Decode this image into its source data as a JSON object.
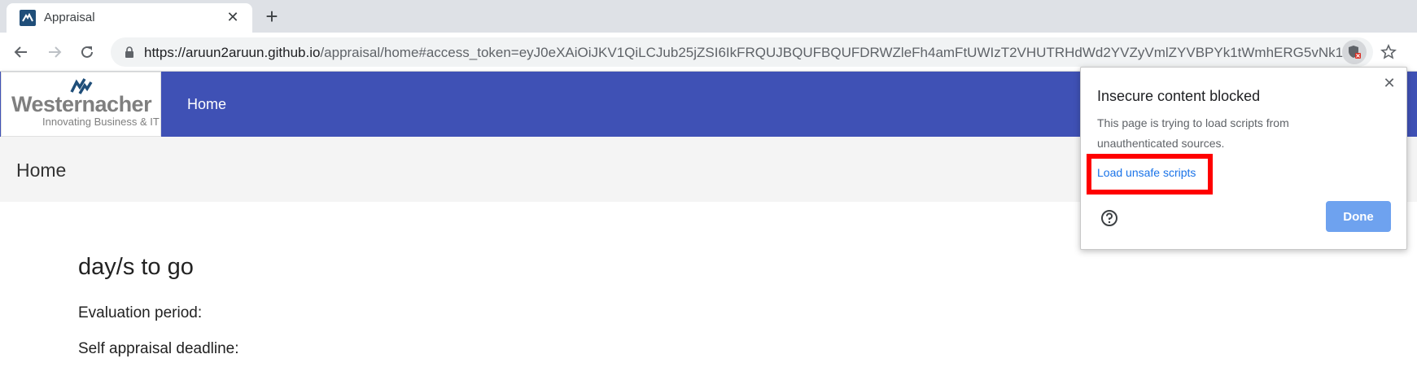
{
  "browser": {
    "tab": {
      "title": "Appraisal",
      "close": "✕",
      "favicon": "site-favicon"
    },
    "new_tab": "+",
    "url_host": "https://aruun2aruun.github.io",
    "url_rest": "/appraisal/home#access_token=eyJ0eXAiOiJKV1QiLCJub25jZSI6IkFRQUJBQUFBQUFDRWZleFh4amFtUWIzT2VHUTRHdWd2YVZyVmlZYVBPYk1tWmhERG5vNk1...",
    "icons": {
      "back": "back-arrow-icon",
      "forward": "forward-arrow-icon",
      "reload": "reload-icon",
      "lock": "lock-icon",
      "shield": "blocked-shield-icon",
      "star": "bookmark-star-icon"
    }
  },
  "site": {
    "logo_main": "Westernacher",
    "logo_sub": "Innovating Business & IT",
    "nav_home": "Home",
    "header_color": "#3f51b5"
  },
  "page": {
    "title": "Home",
    "days_to_go": "day/s to go",
    "evaluation_period": "Evaluation period:",
    "self_appraisal_deadline": "Self appraisal deadline:"
  },
  "popup": {
    "title": "Insecure content blocked",
    "close": "✕",
    "body": "This page is trying to load scripts from unauthenticated sources.",
    "load_link": "Load unsafe scripts",
    "done": "Done",
    "highlight_color": "#ff0000"
  }
}
